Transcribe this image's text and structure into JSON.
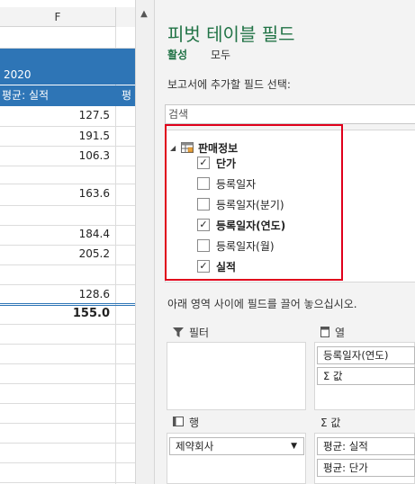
{
  "sheet": {
    "column_letter": "F",
    "year_header": "2020",
    "col_header_a": "평균: 실적",
    "col_header_b": "평",
    "values": [
      "127.5",
      "191.5",
      "106.3",
      "",
      "163.6",
      "",
      "184.4",
      "205.2",
      "",
      "128.6"
    ],
    "total": "155.0"
  },
  "panel": {
    "title": "피벗 테이블 필드",
    "tabs": [
      "활성",
      "모두"
    ],
    "choose_label": "보고서에 추가할 필드 선택:",
    "search_placeholder": "검색",
    "table_name": "판매정보",
    "fields": [
      {
        "label": "단가",
        "checked": true,
        "bold": true
      },
      {
        "label": "등록일자",
        "checked": false,
        "bold": false
      },
      {
        "label": "등록일자(분기)",
        "checked": false,
        "bold": false
      },
      {
        "label": "등록일자(연도)",
        "checked": true,
        "bold": true
      },
      {
        "label": "등록일자(월)",
        "checked": false,
        "bold": false
      },
      {
        "label": "실적",
        "checked": true,
        "bold": true
      }
    ],
    "drag_note": "아래 영역 사이에 필드를 끌어 놓으십시오.",
    "areas": {
      "filter": {
        "title": "필터"
      },
      "columns": {
        "title": "열",
        "items": [
          "등록일자(연도)",
          "Σ 값"
        ]
      },
      "rows": {
        "title": "행",
        "items": [
          "제약회사"
        ]
      },
      "values": {
        "title": "Σ 값",
        "items": [
          "평균: 실적",
          "평균: 단가"
        ]
      }
    }
  },
  "colors": {
    "accent": "#217346",
    "header_blue": "#2e75b6",
    "highlight_red": "#e0001b"
  }
}
